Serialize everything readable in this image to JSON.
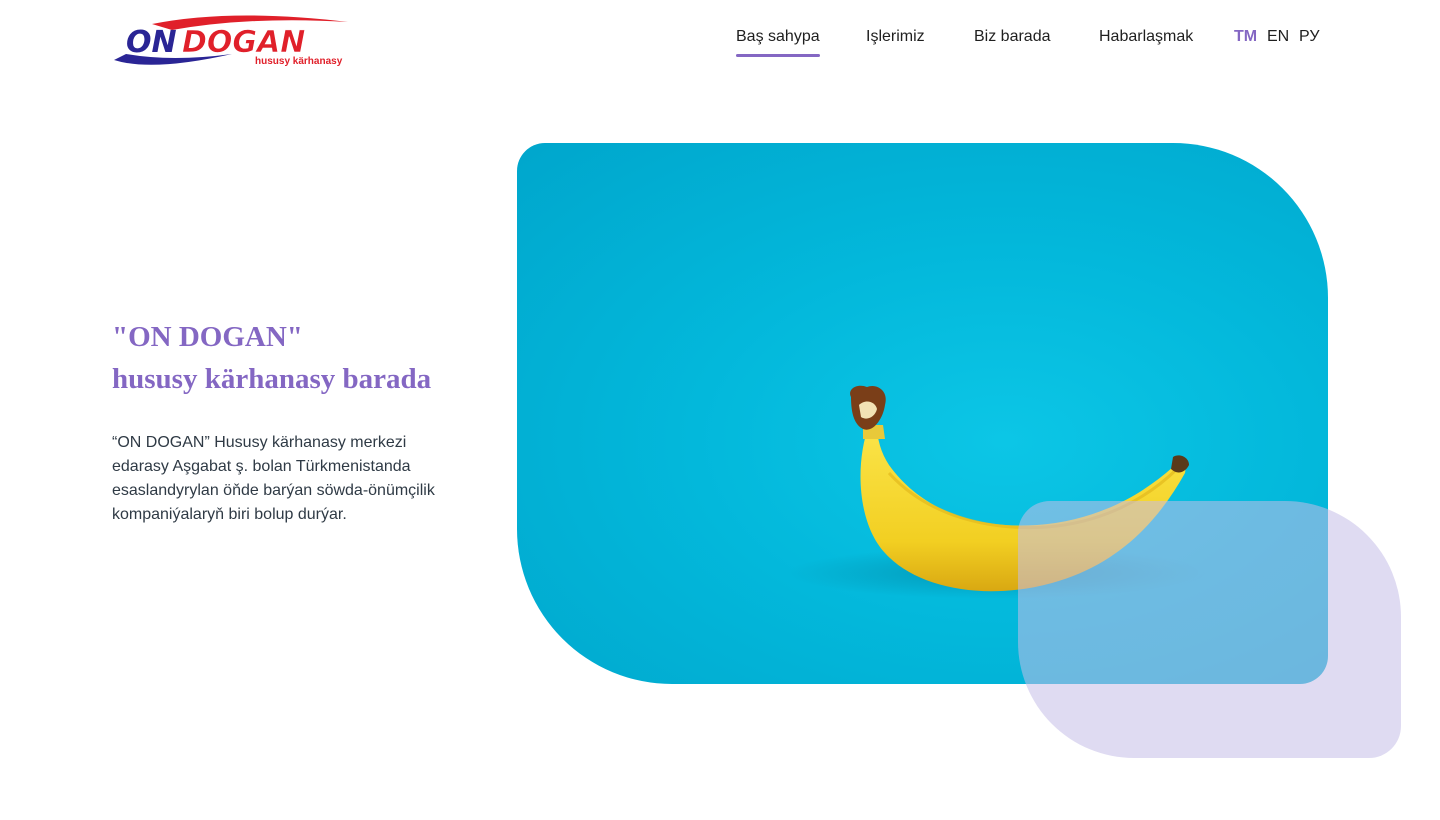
{
  "logo": {
    "wordmark_on": "ON",
    "wordmark_dogan": "DOGAN",
    "tagline": "hususy kärhanasy"
  },
  "nav": {
    "items": [
      {
        "label": "Baş sahypa",
        "active": true
      },
      {
        "label": "Işlerimiz",
        "active": false
      },
      {
        "label": "Biz barada",
        "active": false
      },
      {
        "label": "Habarlaşmak",
        "active": false
      }
    ],
    "languages": [
      {
        "label": "TM",
        "active": true
      },
      {
        "label": "EN",
        "active": false
      },
      {
        "label": "РУ",
        "active": false
      }
    ]
  },
  "hero": {
    "title_line1": "\"ON DOGAN\"",
    "title_line2": "hususy kärhanasy barada",
    "description": "“ON DOGAN” Hususy kärhanasy merkezi edarasy Aşgabat ş. bolan Türkmenistanda esaslandyrylan öňde barýan söwda-önümçilik kompaniýalaryň biri bolup durýar."
  },
  "colors": {
    "accent": "#8467c3",
    "logo_red": "#e0202a",
    "logo_blue": "#2a2595",
    "image_bg": "#03b8db",
    "deco_shape": "#c4bde8",
    "banana": "#f6d92b"
  }
}
